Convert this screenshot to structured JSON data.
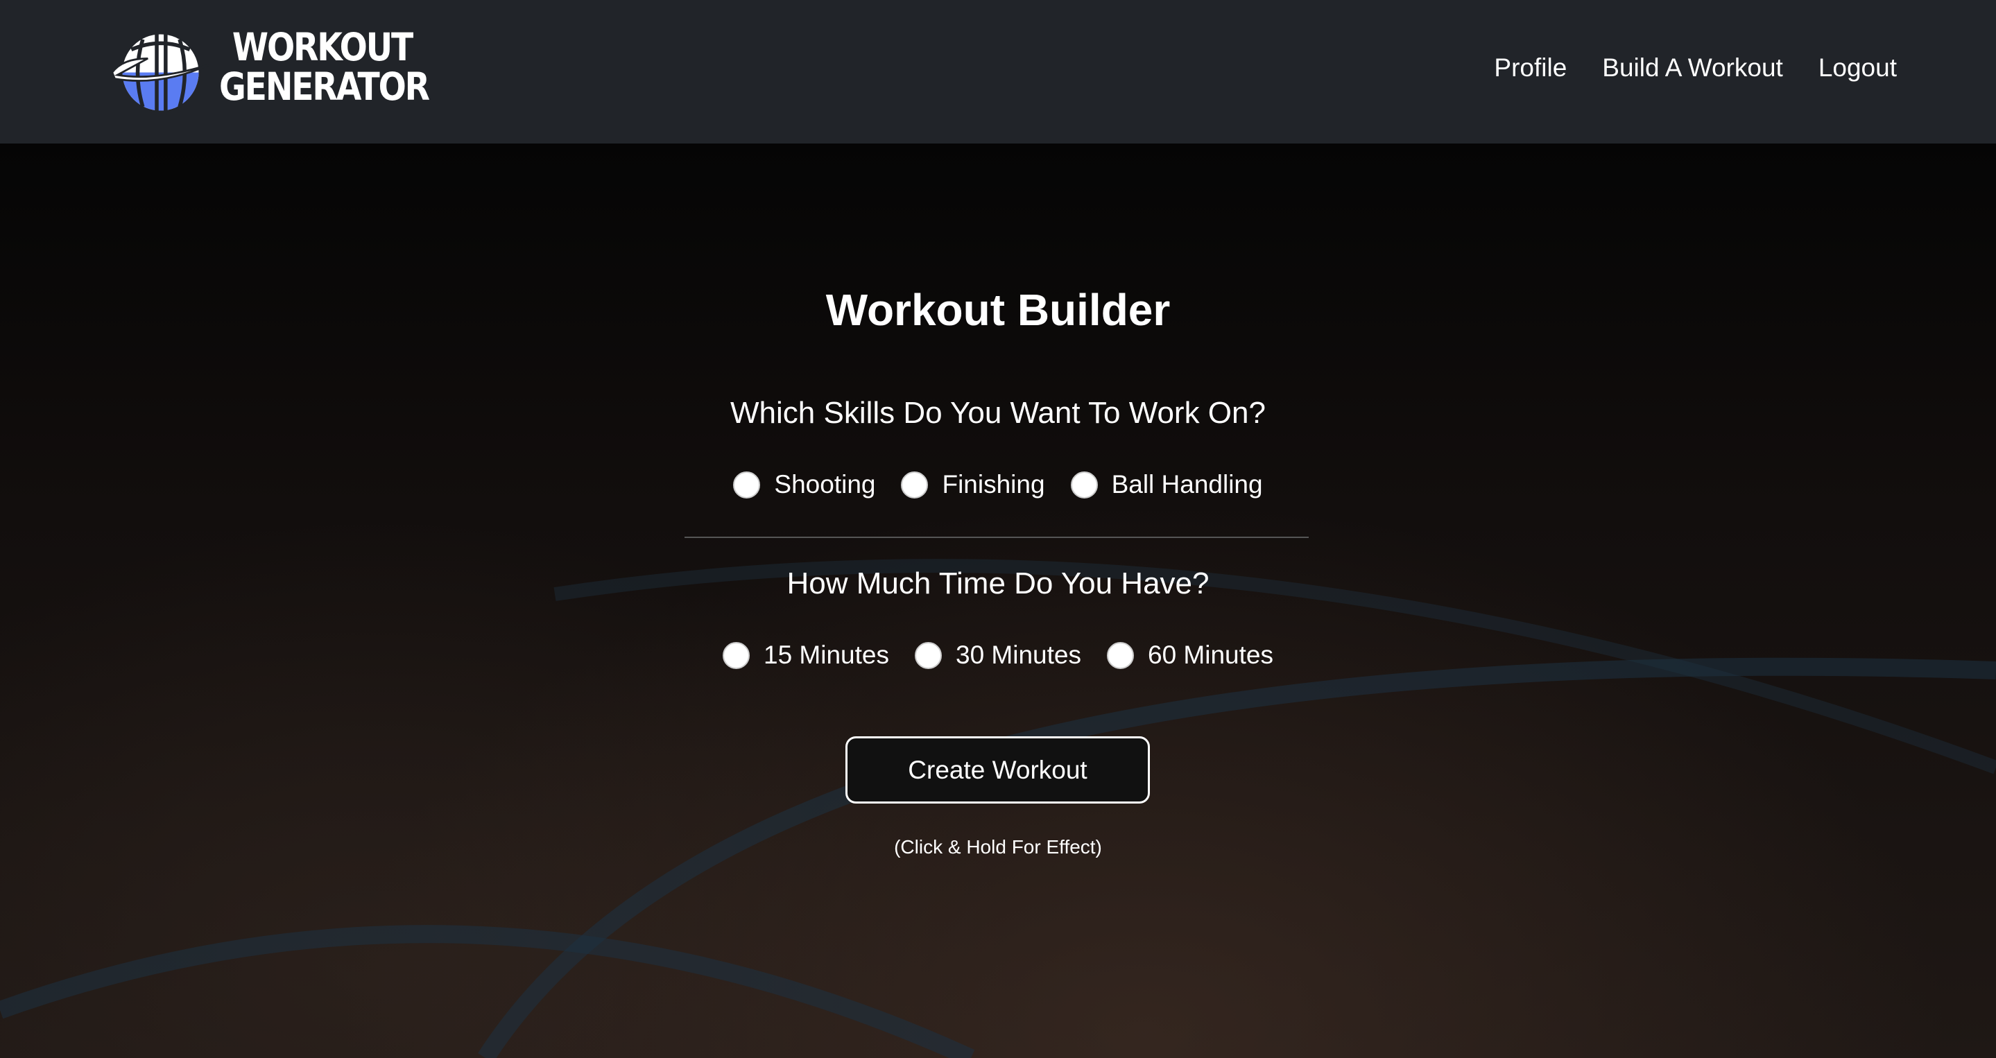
{
  "brand": {
    "line1": "WORKOUT",
    "line2": "GENERATOR",
    "ball_color": "#5a7cf2"
  },
  "nav": {
    "links": [
      "Profile",
      "Build A Workout",
      "Logout"
    ]
  },
  "builder": {
    "title": "Workout Builder",
    "skills_question": "Which Skills Do You Want To Work On?",
    "skills": [
      "Shooting",
      "Finishing",
      "Ball Handling"
    ],
    "time_question": "How Much Time Do You Have?",
    "times": [
      "15 Minutes",
      "30 Minutes",
      "60 Minutes"
    ],
    "create_button": "Create Workout",
    "hint": "(Click & Hold For Effect)"
  }
}
